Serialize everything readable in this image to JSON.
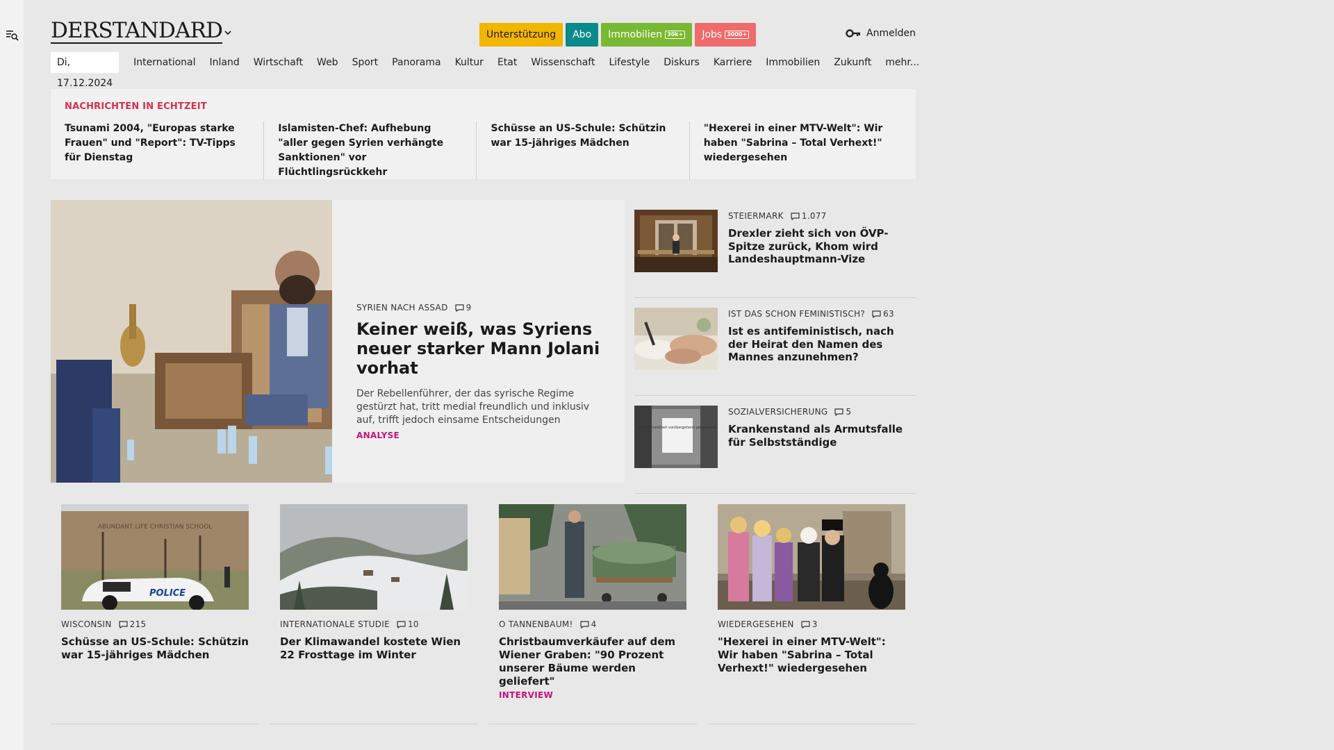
{
  "header": {
    "logo": "DERSTANDARD",
    "buttons": [
      {
        "label": "Unterstützung",
        "color": "#f2b500",
        "text_color": "#1a1a1a",
        "badge": ""
      },
      {
        "label": "Abo",
        "color": "#0b8a8a",
        "text_color": "#ffffff",
        "badge": ""
      },
      {
        "label": "Immobilien",
        "color": "#79b832",
        "text_color": "#ffffff",
        "badge": "30k+"
      },
      {
        "label": "Jobs",
        "color": "#ef6b6b",
        "text_color": "#ffffff",
        "badge": "3000+"
      }
    ],
    "login_label": "Anmelden"
  },
  "nav": {
    "date": "Di, 17.12.2024",
    "items": [
      "International",
      "Inland",
      "Wirtschaft",
      "Web",
      "Sport",
      "Panorama",
      "Kultur",
      "Etat",
      "Wissenschaft",
      "Lifestyle",
      "Diskurs",
      "Karriere",
      "Immobilien",
      "Zukunft",
      "mehr..."
    ]
  },
  "ticker": {
    "title": "NACHRICHTEN IN ECHTZEIT",
    "items": [
      "Tsunami 2004, \"Europas starke Frauen\" und \"Report\": TV-Tipps für Dienstag",
      "Islamisten-Chef: Aufhebung \"aller gegen Syrien verhängte Sanktionen\" vor Flüchtlingsrückkehr",
      "Schüsse an US-Schule: Schützin war 15-jähriges Mädchen",
      "\"Hexerei in einer MTV-Welt\": Wir haben \"Sabrina – Total Verhext!\" wiedergesehen"
    ]
  },
  "lead": {
    "kicker": "SYRIEN NACH ASSAD",
    "comments": "9",
    "title": "Keiner weiß, was Syriens neuer starker Mann Jolani vorhat",
    "description": "Der Rebellenführer, der das syrische Regime gestürzt hat, tritt medial freundlich und inklusiv auf, trifft jedoch einsame Entscheidungen",
    "tag": "ANALYSE"
  },
  "side": [
    {
      "kicker": "STEIERMARK",
      "comments": "1.077",
      "title": "Drexler zieht sich von ÖVP-Spitze zurück, Khom wird Landeshauptmann-Vize"
    },
    {
      "kicker": "IST DAS SCHON FEMINISTISCH?",
      "comments": "63",
      "title": "Ist es antifeministisch, nach der Heirat den Namen des Mannes anzunehmen?"
    },
    {
      "kicker": "SOZIALVERSICHERUNG",
      "comments": "5",
      "title": "Krankenstand als Armutsfalle für Selbstständige"
    }
  ],
  "cards": [
    {
      "kicker": "WISCONSIN",
      "comments": "215",
      "title": "Schüsse an US-Schule: Schützin war 15-jähriges Mädchen",
      "tag": ""
    },
    {
      "kicker": "INTERNATIONALE STUDIE",
      "comments": "10",
      "title": "Der Klimawandel kostete Wien 22 Frosttage im Winter",
      "tag": ""
    },
    {
      "kicker": "O TANNENBAUM!",
      "comments": "4",
      "title": "Christbaumverkäufer auf dem Wiener Graben: \"90 Prozent unserer Bäume werden geliefert\"",
      "tag": "INTERVIEW"
    },
    {
      "kicker": "WIEDERGESEHEN",
      "comments": "3",
      "title": "\"Hexerei in einer MTV-Welt\": Wir haben \"Sabrina – Total Verhext!\" wiedergesehen",
      "tag": ""
    }
  ],
  "images": {
    "police_sign": "POLICE",
    "police_building": "ABUNDANT LIFE CHRISTIAN SCHOOL",
    "sick_sign": "Wegen Krankheit vorübergehend geschlossen"
  },
  "colors": {
    "accent_red": "#d4324a",
    "tag_magenta": "#c4127e"
  }
}
